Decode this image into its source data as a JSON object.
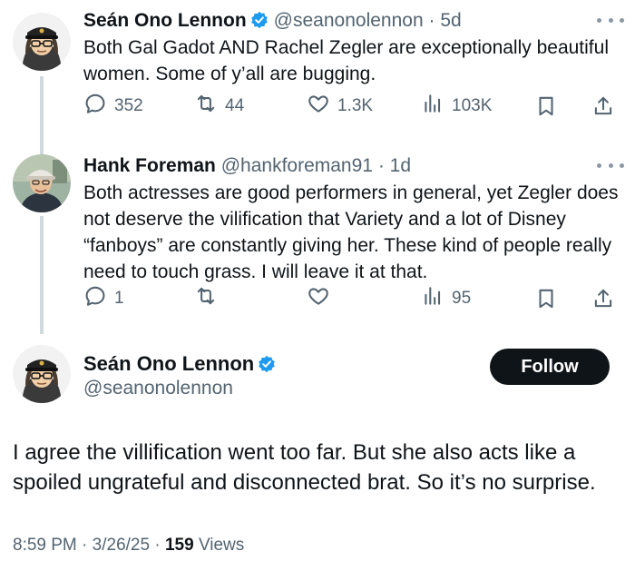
{
  "tweets": [
    {
      "display_name": "Seán Ono Lennon",
      "handle": "@seanonolennon",
      "separator": "·",
      "time": "5d",
      "verified": true,
      "text": "Both Gal Gadot AND Rachel Zegler are exceptionally beautiful women. Some of y’all are bugging.",
      "actions": {
        "replies": "352",
        "reposts": "44",
        "likes": "1.3K",
        "views": "103K"
      }
    },
    {
      "display_name": "Hank Foreman",
      "handle": "@hankforeman91",
      "separator": "·",
      "time": "1d",
      "verified": false,
      "text": "Both actresses are good performers in general, yet Zegler does not deserve the vilification that Variety and a lot of Disney “fanboys” are constantly giving her. These kind of people really need to touch grass. I will leave it at that.",
      "actions": {
        "replies": "1",
        "reposts": "",
        "likes": "",
        "views": "95"
      }
    }
  ],
  "main_tweet": {
    "display_name": "Seán Ono Lennon",
    "handle": "@seanonolennon",
    "verified": true,
    "follow_label": "Follow",
    "text": "I agree the villification went too far. But she also acts like a spoiled ungrateful and disconnected brat. So it’s no surprise.",
    "time": "8:59 PM",
    "separator": "·",
    "date": "3/26/25",
    "views_count": "159",
    "views_label": "Views"
  },
  "colors": {
    "text": "#0f1419",
    "secondary": "#536471",
    "verified_blue": "#1d9bf0",
    "thread_line": "#cfd9de",
    "follow_bg": "#0f1419"
  },
  "icons": [
    "verified-badge-icon",
    "more-icon",
    "reply-icon",
    "repost-icon",
    "like-icon",
    "views-icon",
    "bookmark-icon",
    "share-icon"
  ]
}
